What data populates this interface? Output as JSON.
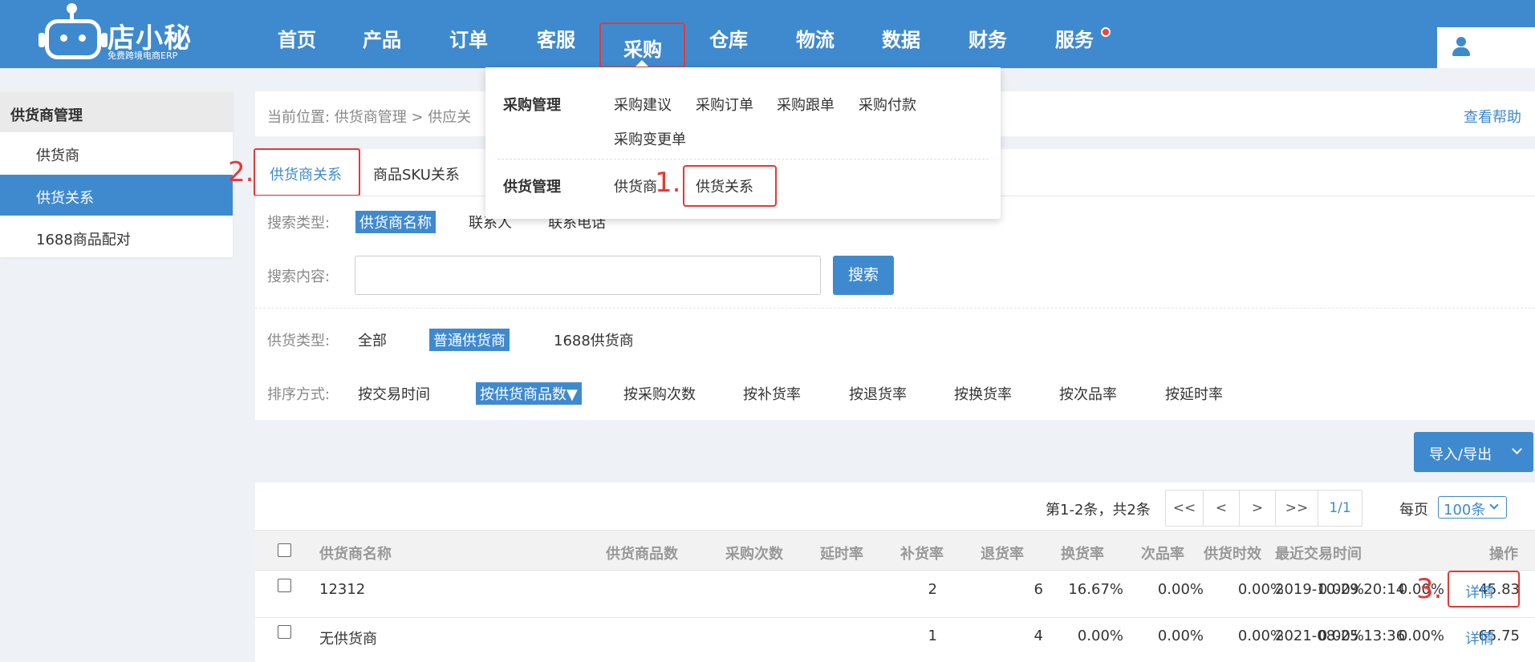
{
  "brand": {
    "name": "店小秘",
    "tagline": "免费跨境电商ERP"
  },
  "nav": {
    "items": [
      "首页",
      "产品",
      "订单",
      "客服",
      "采购",
      "仓库",
      "物流",
      "数据",
      "财务",
      "服务"
    ],
    "active": "采购"
  },
  "sidebar": {
    "header": "供货商管理",
    "items": [
      "供货商",
      "供货关系",
      "1688商品配对"
    ],
    "active_item": "供货关系"
  },
  "breadcrumb": {
    "text": "当前位置:  供货商管理 > 供应关",
    "help": "查看帮助"
  },
  "tabs": [
    "供货商关系",
    "商品SKU关系"
  ],
  "filters": {
    "search_type_label": "搜索类型:",
    "search_types": [
      "供货商名称",
      "联系人",
      "联系电话"
    ],
    "search_content_label": "搜索内容:",
    "search_input_value": "",
    "search_button": "搜索",
    "supply_type_label": "供货类型:",
    "supply_types": [
      "全部",
      "普通供货商",
      "1688供货商"
    ],
    "sort_label": "排序方式:",
    "sort_options": [
      "按交易时间",
      "按供货商品数▼",
      "按采购次数",
      "按补货率",
      "按退货率",
      "按换货率",
      "按次品率",
      "按延时率"
    ]
  },
  "import_export": "导入/导出",
  "pager": {
    "info": "第1-2条，共2条",
    "first": "<<",
    "prev": "<",
    "next": ">",
    "last": ">>",
    "current": "1/1",
    "per_page_label": "每页",
    "per_page_value": "100条"
  },
  "table": {
    "headers": [
      "供货商名称",
      "供货商品数",
      "采购次数",
      "延时率",
      "补货率",
      "退货率",
      "换货率",
      "次品率",
      "供货时效",
      "最近交易时间",
      "操作"
    ],
    "rows": [
      {
        "name": "12312",
        "items": "2",
        "purchases": "6",
        "delay": "16.67%",
        "restock": "0.00%",
        "return": "0.00%",
        "exchange": "0.00%",
        "defect": "0.00%",
        "lead_time": "45.83",
        "last_trade": "2019-10-29 20:14",
        "action": "详情"
      },
      {
        "name": "无供货商",
        "items": "1",
        "purchases": "4",
        "delay": "0.00%",
        "restock": "0.00%",
        "return": "0.00%",
        "exchange": "0.00%",
        "defect": "0.00%",
        "lead_time": "65.75",
        "last_trade": "2021-08-25 13:36",
        "action": "详情"
      }
    ]
  },
  "dropdown": {
    "group1_title": "采购管理",
    "group1_items": [
      "采购建议",
      "采购订单",
      "采购跟单",
      "采购付款",
      "采购变更单"
    ],
    "group2_title": "供货管理",
    "group2_items": [
      "供货商",
      "供货关系"
    ]
  },
  "annotations": {
    "step1": "1.",
    "step2": "2.",
    "step3": "3."
  },
  "colors": {
    "primary": "#3f8ace",
    "annotation_red": "#e53935",
    "background": "#eef1f5"
  }
}
